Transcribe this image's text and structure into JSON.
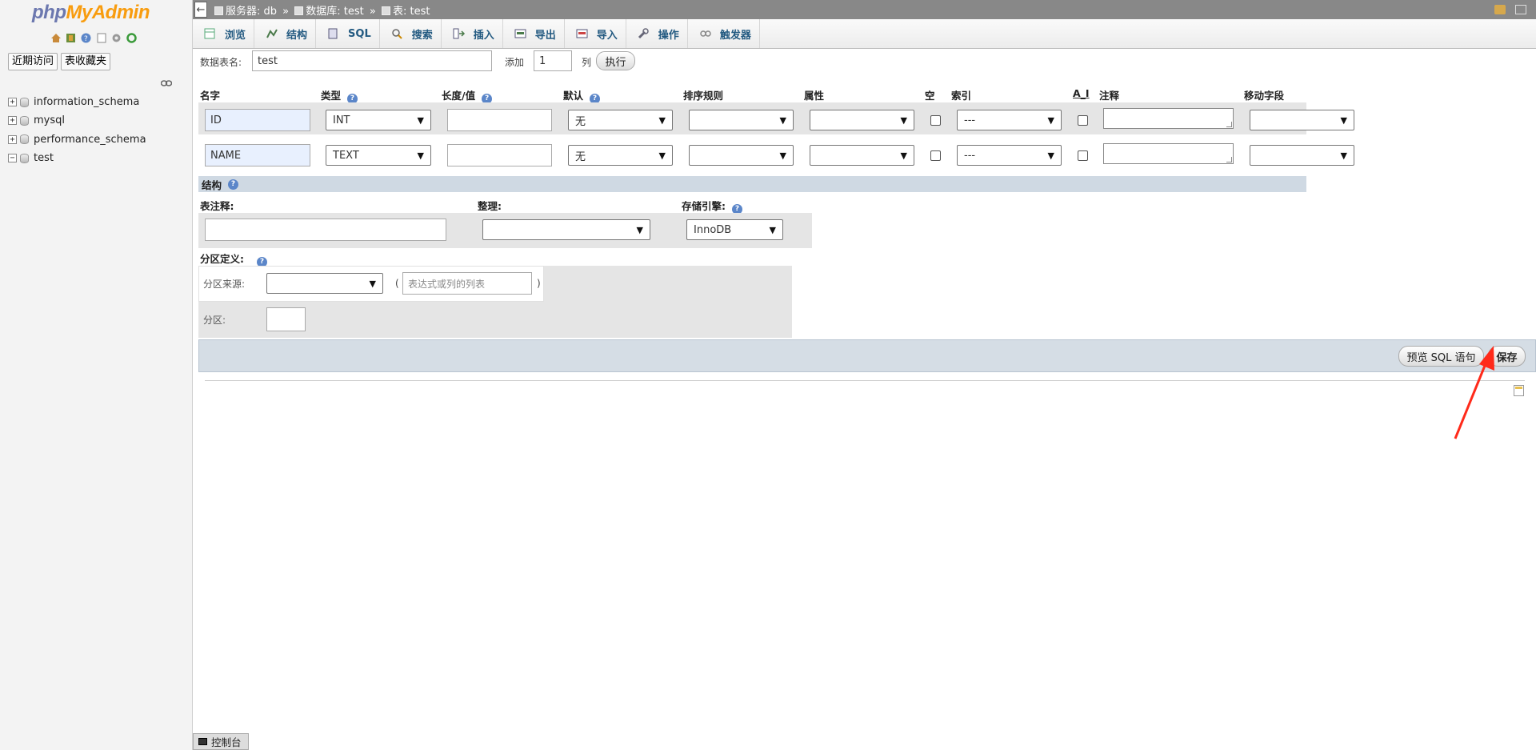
{
  "nav": {
    "logo_php": "php",
    "logo_myadmin": "MyAdmin",
    "recent_label": "近期访问",
    "favorites_label": "表收藏夹",
    "databases": [
      {
        "name": "information_schema",
        "expander": "+"
      },
      {
        "name": "mysql",
        "expander": "+"
      },
      {
        "name": "performance_schema",
        "expander": "+"
      },
      {
        "name": "test",
        "expander": "−"
      }
    ]
  },
  "topbar": {
    "server": "服务器: db",
    "database": "数据库: test",
    "table": "表: test",
    "sep": "»",
    "back": "←"
  },
  "tabs": [
    "浏览",
    "结构",
    "SQL",
    "搜索",
    "插入",
    "导出",
    "导入",
    "操作",
    "触发器"
  ],
  "form": {
    "table_name_label": "数据表名:",
    "table_name_value": "test",
    "add_label": "添加",
    "add_count": "1",
    "columns_label": "列",
    "go_button": "执行"
  },
  "columns_header": [
    "名字",
    "类型",
    "长度/值",
    "默认",
    "排序规则",
    "属性",
    "空",
    "索引",
    "A_I",
    "注释",
    "移动字段"
  ],
  "rows": [
    {
      "name": "ID",
      "type": "INT",
      "length": "",
      "default": "无",
      "collation": "",
      "attribute": "",
      "index": "---",
      "comment": ""
    },
    {
      "name": "NAME",
      "type": "TEXT",
      "length": "",
      "default": "无",
      "collation": "",
      "attribute": "",
      "index": "---",
      "comment": ""
    }
  ],
  "structure": {
    "header": "结构",
    "table_comment_label": "表注释:",
    "collation_label": "整理:",
    "engine_label": "存储引擎:",
    "engine_value": "InnoDB"
  },
  "partition": {
    "header": "分区定义:",
    "source_label": "分区来源:",
    "open_paren": "(",
    "close_paren": ")",
    "expr_placeholder": "表达式或列的列表",
    "partitions_label": "分区:"
  },
  "actions": {
    "preview_sql": "预览 SQL 语句",
    "save": "保存"
  },
  "console": {
    "label": "控制台"
  },
  "colors": {
    "annotation_arrow": "#ff2a1a",
    "tab_text": "#235a81"
  }
}
